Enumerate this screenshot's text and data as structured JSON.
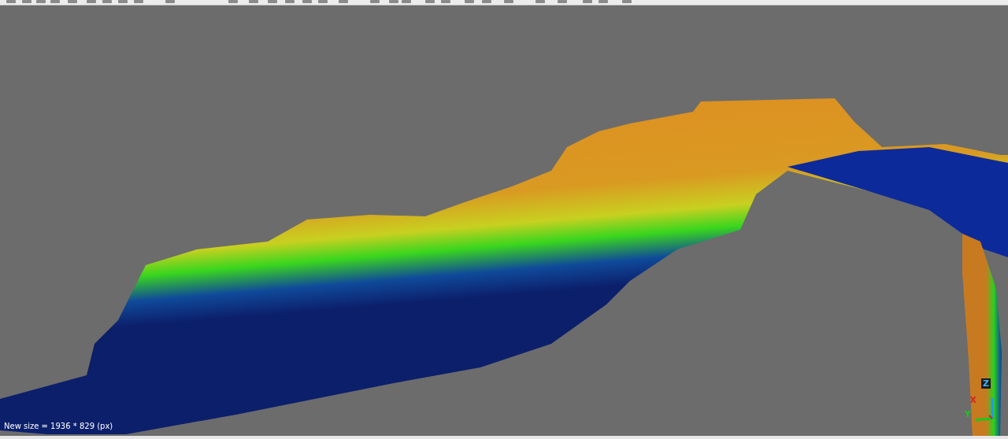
{
  "viewport": {
    "message": "New size = 1936 * 829 (px)",
    "axes": [
      {
        "label": "Z"
      },
      {
        "label": "X"
      },
      {
        "label": "Y"
      }
    ]
  }
}
